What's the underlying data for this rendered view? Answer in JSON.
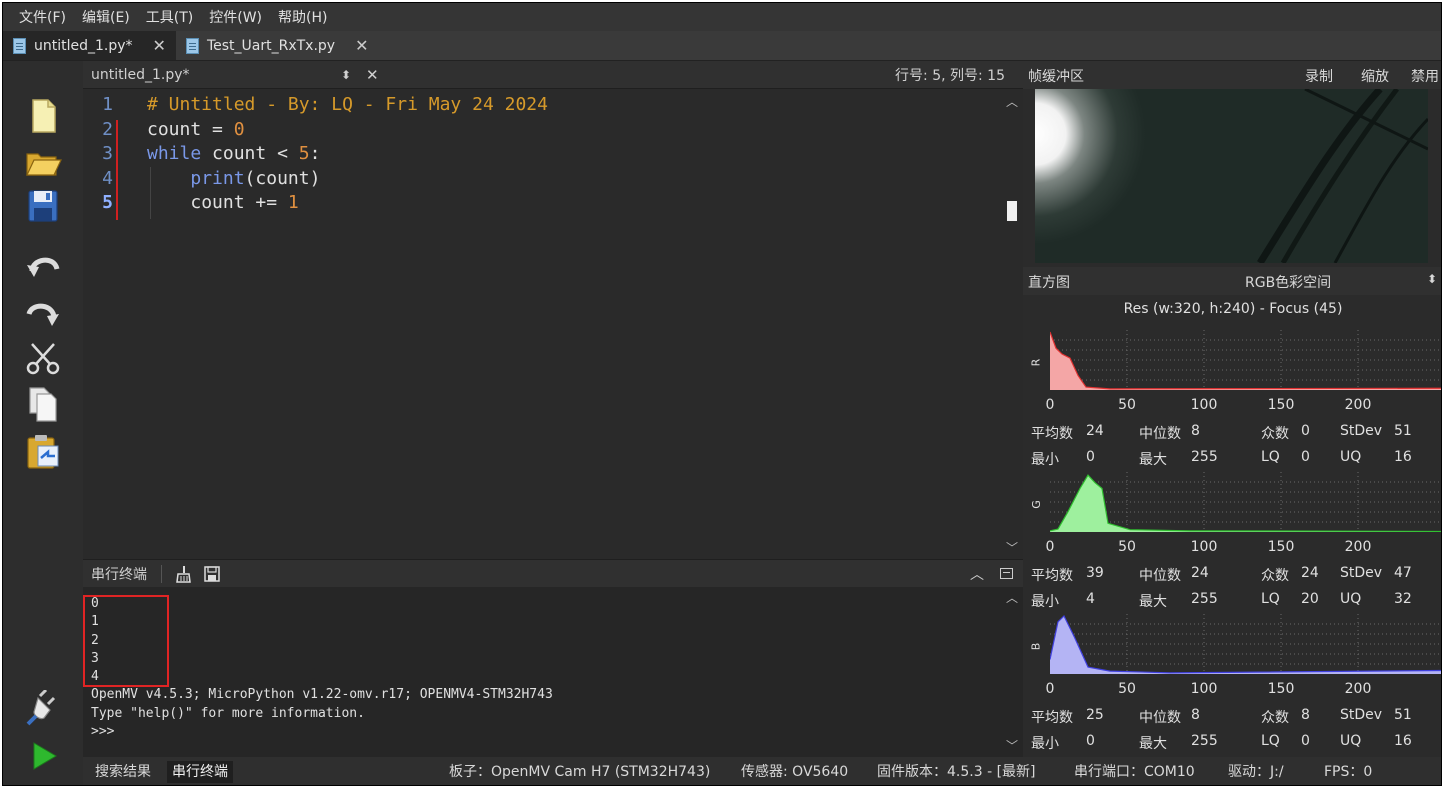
{
  "menu": [
    "文件(F)",
    "编辑(E)",
    "工具(T)",
    "控件(W)",
    "帮助(H)"
  ],
  "file_tabs": [
    {
      "label": "untitled_1.py*",
      "active": true
    },
    {
      "label": "Test_Uart_RxTx.py",
      "active": false
    }
  ],
  "editor": {
    "filename": "untitled_1.py*",
    "cursor_position": "行号: 5, 列号: 15",
    "line_numbers": [
      "1",
      "2",
      "3",
      "4",
      "5"
    ],
    "lines": [
      "# Untitled - By: LQ - Fri May 24 2024",
      "count = 0",
      "while count < 5:",
      "    print(count)",
      "    count += 1"
    ]
  },
  "terminal": {
    "title": "串行终端",
    "lines": [
      "0",
      "1",
      "2",
      "3",
      "4",
      "OpenMV v4.5.3; MicroPython v1.22-omv.r17; OPENMV4-STM32H743",
      "Type \"help()\" for more information.",
      ">>>"
    ]
  },
  "statusbar": {
    "tabs": [
      "搜索结果",
      "串行终端"
    ],
    "board": "板子：OpenMV Cam H7 (STM32H743)",
    "sensor": "传感器: OV5640",
    "firmware": "固件版本：4.5.3 - [最新]",
    "serial_port": "串行端口：COM10",
    "drive": "驱动：J:/",
    "fps": "FPS：0"
  },
  "frame_buffer": {
    "title": "帧缓冲区",
    "buttons": [
      "录制",
      "缩放",
      "禁用"
    ]
  },
  "histogram": {
    "title": "直方图",
    "color_space": "RGB色彩空间",
    "resolution_focus": "Res (w:320, h:240) - Focus (45)",
    "axis_ticks": [
      "0",
      "50",
      "100",
      "150",
      "200"
    ],
    "stat_labels": {
      "mean": "平均数",
      "median": "中位数",
      "mode": "众数",
      "stdev": "StDev",
      "min": "最小",
      "max": "最大",
      "lq": "LQ",
      "uq": "UQ"
    },
    "channels": [
      {
        "name": "R",
        "color": "#f4a6a6",
        "line_color": "#e03030",
        "stats": {
          "mean": "24",
          "median": "8",
          "mode": "0",
          "stdev": "51",
          "min": "0",
          "max": "255",
          "lq": "0",
          "uq": "16"
        }
      },
      {
        "name": "G",
        "color": "#9ef09e",
        "line_color": "#30c030",
        "stats": {
          "mean": "39",
          "median": "24",
          "mode": "24",
          "stdev": "47",
          "min": "4",
          "max": "255",
          "lq": "20",
          "uq": "32"
        }
      },
      {
        "name": "B",
        "color": "#b4b4f4",
        "line_color": "#4040e0",
        "stats": {
          "mean": "25",
          "median": "8",
          "mode": "8",
          "stdev": "51",
          "min": "0",
          "max": "255",
          "lq": "0",
          "uq": "16"
        }
      }
    ]
  },
  "colors": {
    "background": "#2b2b2b",
    "comment": "#d69a2a",
    "keyword": "#7a98e8",
    "number": "#e09040",
    "highlight_box": "#e02424"
  }
}
